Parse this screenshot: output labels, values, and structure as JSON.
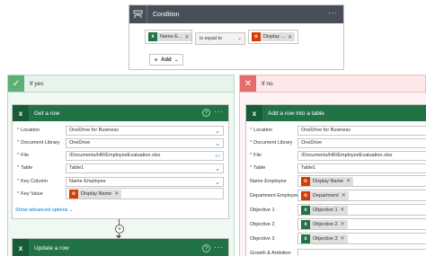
{
  "condition": {
    "title": "Condition",
    "left_token": "Name E...",
    "operator": "is equal to",
    "right_token": "Display ...",
    "add_label": "Add"
  },
  "branches": {
    "yes_label": "If yes",
    "no_label": "If no"
  },
  "get_row": {
    "title": "Get a row",
    "fields": [
      {
        "label": "Location",
        "value": "OneDrive for Business"
      },
      {
        "label": "Document Library",
        "value": "OneDrive"
      },
      {
        "label": "File",
        "value": "/Documents/HR/EmployeeEvaluation.xlsx"
      },
      {
        "label": "Table",
        "value": "Table1"
      },
      {
        "label": "Key Column",
        "value": "Name Employee"
      },
      {
        "label": "Key Value",
        "token": "Display Name"
      }
    ],
    "advanced_link": "Show advanced options"
  },
  "update_row": {
    "title": "Update a row"
  },
  "add_row": {
    "title": "Add a row into a table",
    "fields": [
      {
        "label": "Location",
        "value": "OneDrive for Business"
      },
      {
        "label": "Document Library",
        "value": "OneDrive"
      },
      {
        "label": "File",
        "value": "/Documents/HR/EmployeeEvaluation.xlsx"
      },
      {
        "label": "Table",
        "value": "Table1"
      },
      {
        "label": "Name Employee",
        "token": "Display Name"
      },
      {
        "label": "Department Employee",
        "token": "Department"
      },
      {
        "label": "Objective 1",
        "token": "Objective 1"
      },
      {
        "label": "Objective 2",
        "token": "Objective 2"
      },
      {
        "label": "Objective 3",
        "token": "Objective 3"
      },
      {
        "label": "Growth & Ambition",
        "value": ""
      }
    ]
  },
  "colors": {
    "excel": "#217346",
    "office": "#d83b01",
    "condition_header": "#484f58",
    "yes": "#5db075",
    "no": "#e66c6c",
    "link": "#0078d4"
  }
}
